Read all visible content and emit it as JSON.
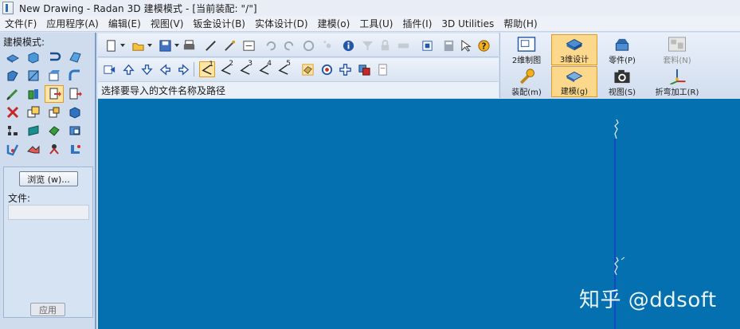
{
  "window": {
    "title": "New Drawing - Radan 3D 建模模式 - [当前装配: \"/\"]"
  },
  "menu": [
    "文件(F)",
    "应用程序(A)",
    "编辑(E)",
    "视图(V)",
    "钣金设计(B)",
    "实体设计(D)",
    "建模(o)",
    "工具(U)",
    "插件(I)",
    "3D Utilities",
    "帮助(H)"
  ],
  "left_panel": {
    "mode_label": "建模模式:",
    "tools": [
      "extrude-icon",
      "revolve-icon",
      "sweep-icon",
      "loft-icon",
      "fillet-icon",
      "chamfer-icon",
      "shell-icon",
      "bend-icon",
      "hole-icon",
      "cylinder-icon",
      "import-file-icon",
      "export-file-icon",
      "delete-icon",
      "copy-icon",
      "pattern-icon",
      "mirror-icon",
      "align-icon",
      "split-icon",
      "unite-icon",
      "subtract-icon",
      "edit-icon",
      "move-icon",
      "measure-icon",
      "transform-icon"
    ],
    "selected_tool": "import-file-icon",
    "browse_label": "浏览 (w)...",
    "file_label": "文件:",
    "file_value": "",
    "apply_label": "应用"
  },
  "toolbar1": [
    "new-file-icon",
    "open-icon",
    "save-icon",
    "print-icon",
    "pen-icon",
    "magic-pen-icon",
    "refresh-icon",
    "undo-icon",
    "redo-icon",
    "rotate-icon",
    "snap-icon",
    "info-icon",
    "filter-icon",
    "lock-icon",
    "ruler-icon",
    "grid-icon",
    "calculator-icon",
    "help-cursor-icon",
    "help-icon"
  ],
  "toolbar2": {
    "buttons": [
      "nav-first-icon",
      "nav-up-icon",
      "nav-down-icon",
      "nav-left-icon",
      "nav-right-icon"
    ],
    "views": [
      "1",
      "2",
      "3",
      "4",
      "5"
    ],
    "selected_view": "1",
    "extra": [
      "shade-icon",
      "target-icon",
      "crosshair-icon",
      "layers-icon",
      "document-icon"
    ]
  },
  "status_text": "选择要导入的文件名称及路径",
  "mode_buttons": [
    {
      "label": "2维制图",
      "icon": "drawing-2d-icon",
      "selected": false,
      "disabled": false
    },
    {
      "label": "3维设计",
      "icon": "design-3d-icon",
      "selected": true,
      "disabled": false
    },
    {
      "label": "零件(P)",
      "icon": "part-icon",
      "selected": false,
      "disabled": false
    },
    {
      "label": "套料(N)",
      "icon": "nesting-icon",
      "selected": false,
      "disabled": true
    },
    {
      "label": "装配(m)",
      "icon": "assembly-icon",
      "selected": false,
      "disabled": false
    },
    {
      "label": "建模(g)",
      "icon": "modeling-icon",
      "selected": true,
      "disabled": false
    },
    {
      "label": "视图(S)",
      "icon": "camera-icon",
      "selected": false,
      "disabled": false
    },
    {
      "label": "折弯加工(R)",
      "icon": "bend-process-icon",
      "selected": false,
      "disabled": false
    }
  ],
  "watermark": "知乎 @ddsoft",
  "colors": {
    "viewport": "#0570b0",
    "panel": "#cfdcee",
    "highlight": "#fcd88c"
  }
}
